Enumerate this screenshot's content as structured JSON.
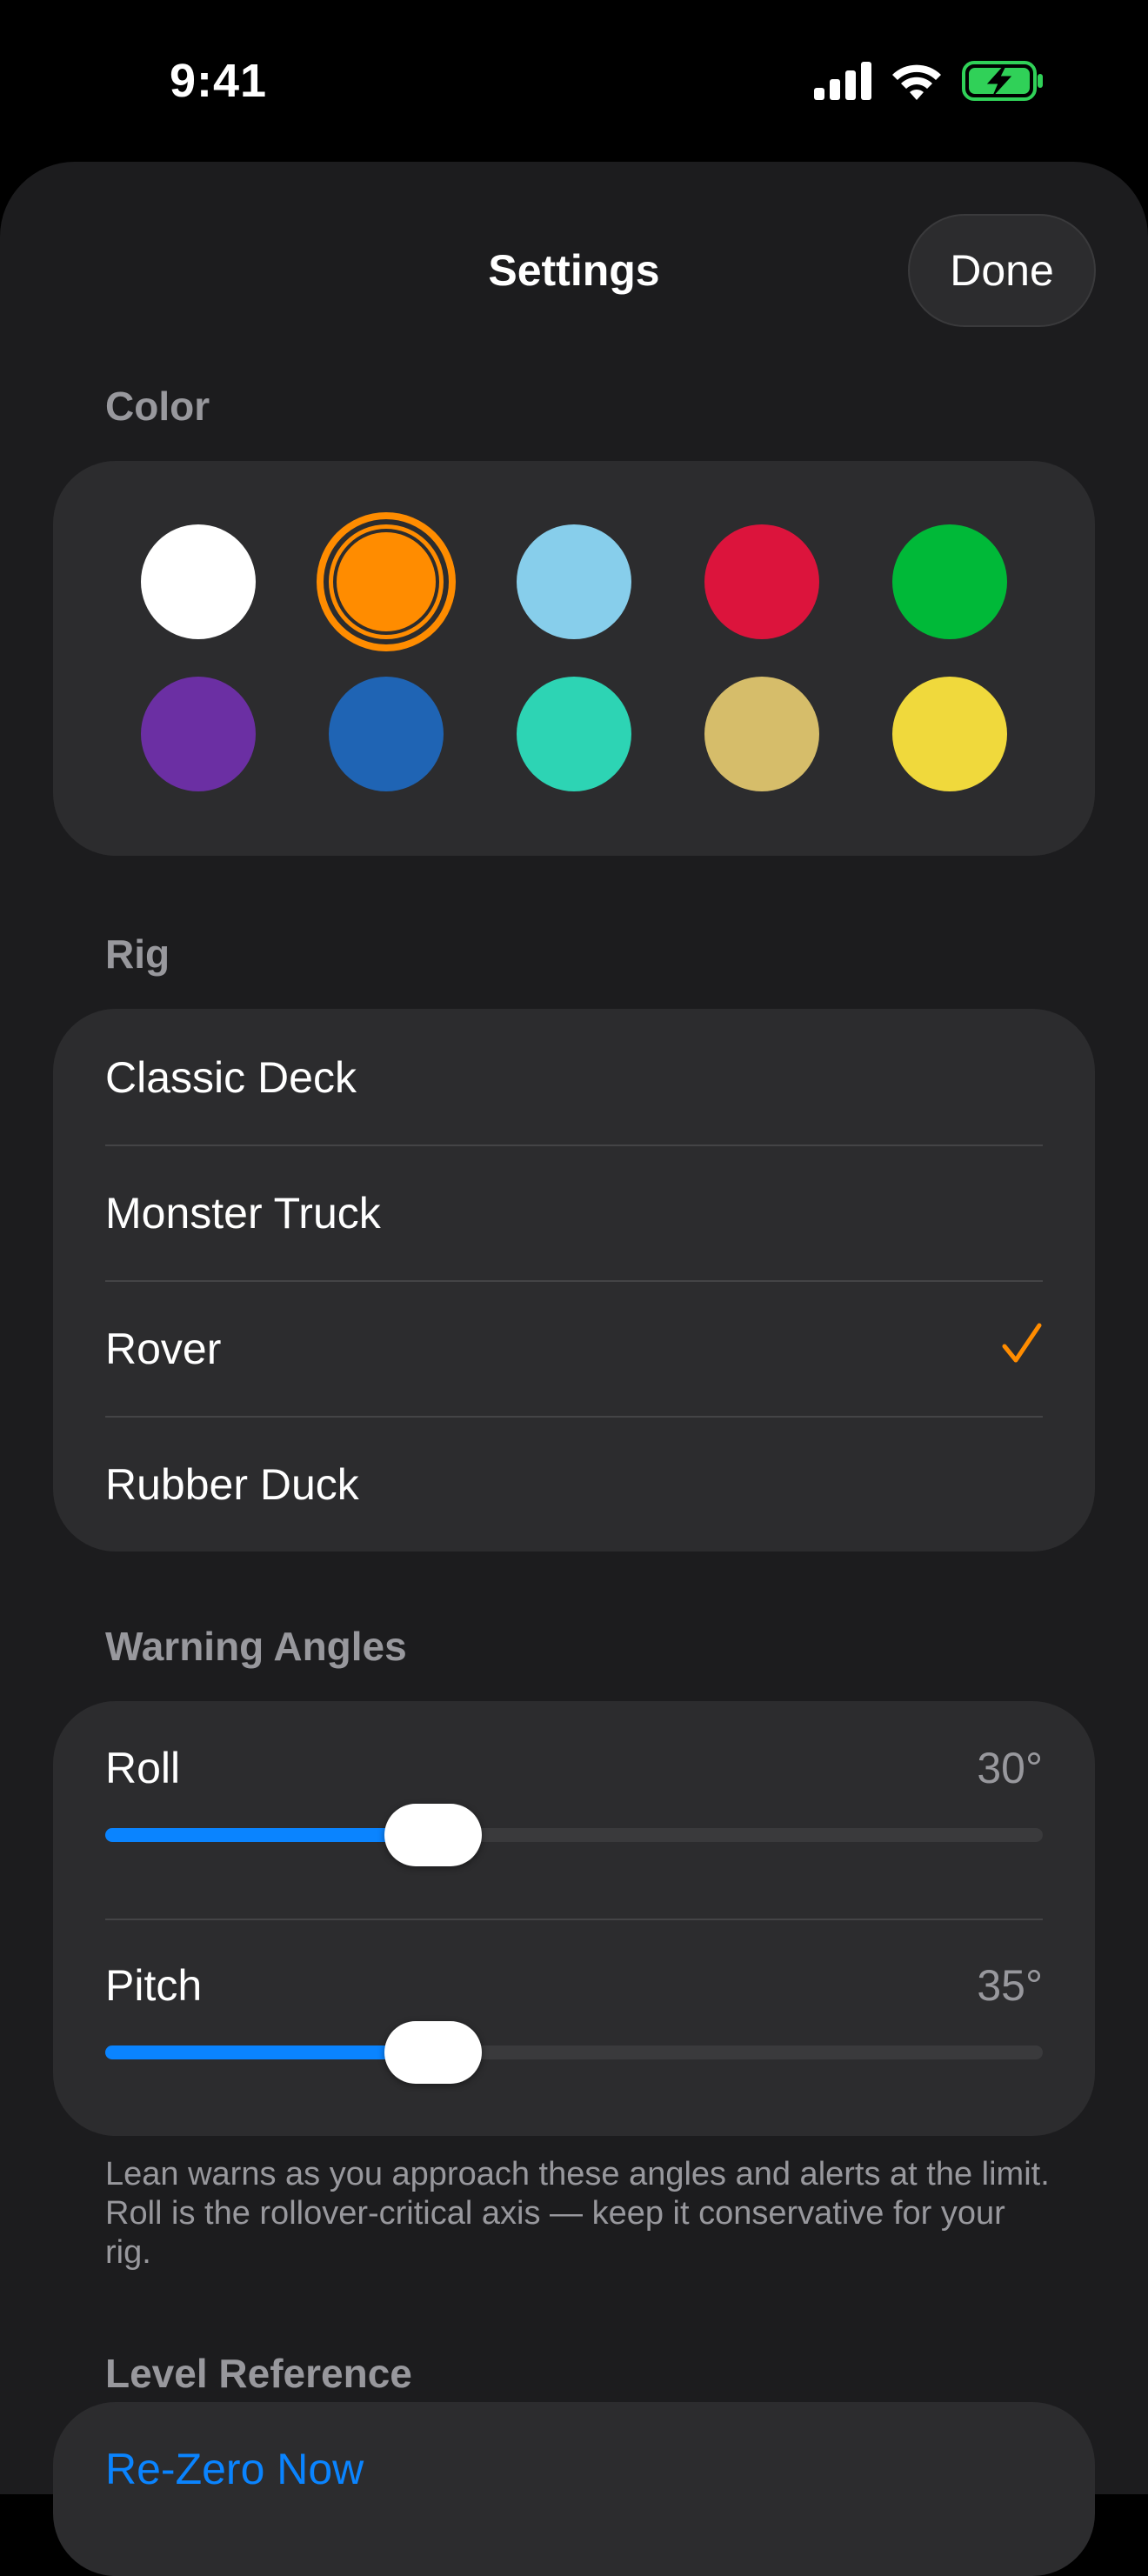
{
  "status": {
    "time": "9:41"
  },
  "nav": {
    "title": "Settings",
    "done_label": "Done"
  },
  "color": {
    "header": "Color",
    "selected": "orange",
    "swatches": [
      {
        "name": "white",
        "hex": "#ffffff"
      },
      {
        "name": "orange",
        "hex": "#ff8c00"
      },
      {
        "name": "light-blue",
        "hex": "#87ceeb"
      },
      {
        "name": "red",
        "hex": "#dc143c"
      },
      {
        "name": "green",
        "hex": "#00b938"
      },
      {
        "name": "purple",
        "hex": "#6b2fa3"
      },
      {
        "name": "blue",
        "hex": "#1f64b4"
      },
      {
        "name": "teal",
        "hex": "#2dd4b4"
      },
      {
        "name": "tan",
        "hex": "#d6bd6a"
      },
      {
        "name": "yellow",
        "hex": "#f0d93c"
      }
    ]
  },
  "rig": {
    "header": "Rig",
    "items": [
      {
        "label": "Classic Deck",
        "selected": false
      },
      {
        "label": "Monster Truck",
        "selected": false
      },
      {
        "label": "Rover",
        "selected": true
      },
      {
        "label": "Rubber Duck",
        "selected": false
      }
    ]
  },
  "warning_angles": {
    "header": "Warning Angles",
    "roll": {
      "label": "Roll",
      "value_text": "30°",
      "fraction": 0.35
    },
    "pitch": {
      "label": "Pitch",
      "value_text": "35°",
      "fraction": 0.35
    },
    "footnote": "Lean warns as you approach these angles and alerts at the limit. Roll is the rollover-critical axis — keep it conservative for your rig."
  },
  "level_reference": {
    "header": "Level Reference",
    "rezero_label": "Re-Zero Now"
  },
  "colors": {
    "accent": "#ff8c00",
    "tint": "#0a84ff",
    "background": "#1c1c1e",
    "card": "#2c2c2e"
  }
}
